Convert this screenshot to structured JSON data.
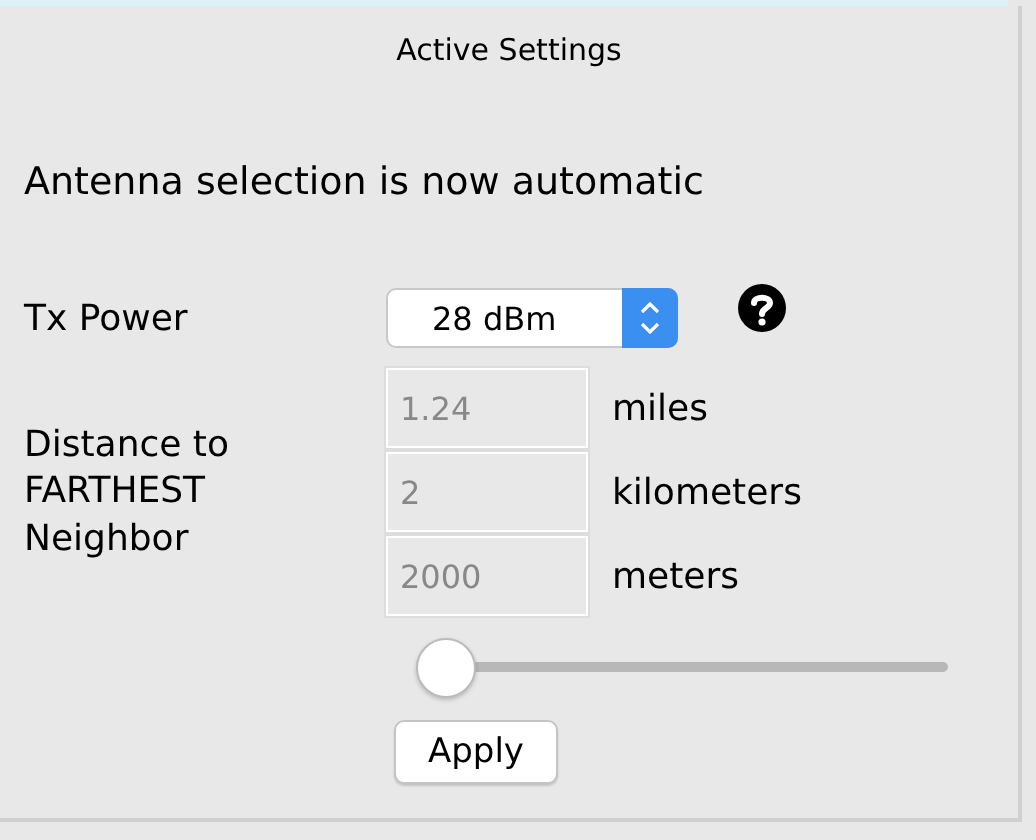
{
  "panel": {
    "title": "Active Settings"
  },
  "notice": "Antenna selection is now automatic",
  "tx_power": {
    "label": "Tx Power",
    "value": "28 dBm"
  },
  "distance": {
    "label": "Distance to FARTHEST Neighbor",
    "fields": [
      {
        "placeholder": "1.24",
        "unit": "miles"
      },
      {
        "placeholder": "2",
        "unit": "kilometers"
      },
      {
        "placeholder": "2000",
        "unit": "meters"
      }
    ],
    "slider": {
      "level": 0.05
    }
  },
  "buttons": [
    "Apply"
  ]
}
